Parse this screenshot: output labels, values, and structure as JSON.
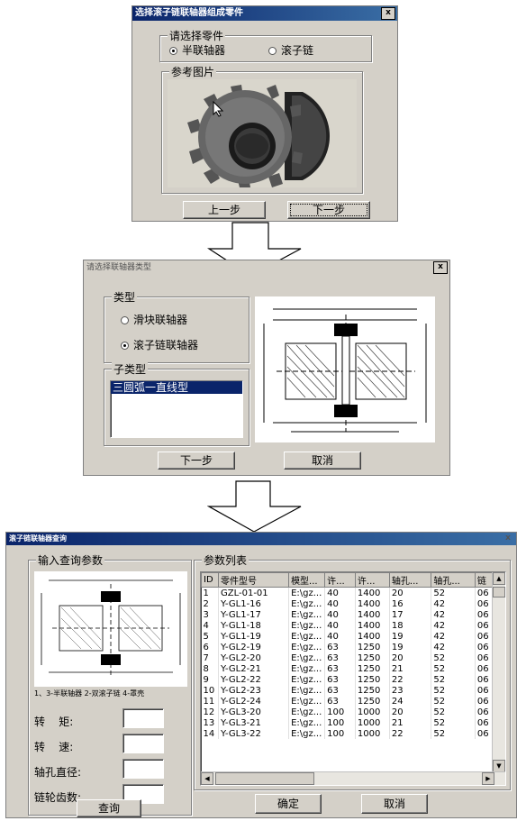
{
  "dialog1": {
    "title": "选择滚子链联轴器组成零件",
    "close": "x",
    "group_parts": "请选择零件",
    "radio_half": "半联轴器",
    "radio_chain": "滚子链",
    "group_image": "参考图片",
    "btn_prev": "上一步",
    "btn_next": "下一步"
  },
  "dialog2": {
    "title": "请选择联轴器类型",
    "close": "x",
    "group_type": "类型",
    "radio_slider": "滑块联轴器",
    "radio_roller": "滚子链联轴器",
    "group_subtype": "子类型",
    "subtype_selected": "三圆弧一直线型",
    "btn_next": "下一步",
    "btn_cancel": "取消"
  },
  "dialog3": {
    "title": "滚子链联轴器查询",
    "close": "x",
    "group_input": "输入查询参数",
    "caption": "1、3-半联轴器 2-双滚子链 4-罩壳",
    "label_torque": "转    矩:",
    "label_speed": "转    速:",
    "label_diameter": "轴孔直径:",
    "label_teeth": "链轮齿数:",
    "btn_query": "查询",
    "group_list": "参数列表",
    "columns": [
      "ID",
      "零件型号",
      "模型...",
      "许...",
      "许...",
      "轴孔...",
      "轴孔...",
      "链"
    ],
    "rows": [
      [
        "1",
        "GZL-01-01",
        "E:\\gz...",
        "40",
        "1400",
        "20",
        "52",
        "06"
      ],
      [
        "2",
        "Y-GL1-16",
        "E:\\gz...",
        "40",
        "1400",
        "16",
        "42",
        "06"
      ],
      [
        "3",
        "Y-GL1-17",
        "E:\\gz...",
        "40",
        "1400",
        "17",
        "42",
        "06"
      ],
      [
        "4",
        "Y-GL1-18",
        "E:\\gz...",
        "40",
        "1400",
        "18",
        "42",
        "06"
      ],
      [
        "5",
        "Y-GL1-19",
        "E:\\gz...",
        "40",
        "1400",
        "19",
        "42",
        "06"
      ],
      [
        "6",
        "Y-GL2-19",
        "E:\\gz...",
        "63",
        "1250",
        "19",
        "42",
        "06"
      ],
      [
        "7",
        "Y-GL2-20",
        "E:\\gz...",
        "63",
        "1250",
        "20",
        "52",
        "06"
      ],
      [
        "8",
        "Y-GL2-21",
        "E:\\gz...",
        "63",
        "1250",
        "21",
        "52",
        "06"
      ],
      [
        "9",
        "Y-GL2-22",
        "E:\\gz...",
        "63",
        "1250",
        "22",
        "52",
        "06"
      ],
      [
        "10",
        "Y-GL2-23",
        "E:\\gz...",
        "63",
        "1250",
        "23",
        "52",
        "06"
      ],
      [
        "11",
        "Y-GL2-24",
        "E:\\gz...",
        "63",
        "1250",
        "24",
        "52",
        "06"
      ],
      [
        "12",
        "Y-GL3-20",
        "E:\\gz...",
        "100",
        "1000",
        "20",
        "52",
        "06"
      ],
      [
        "13",
        "Y-GL3-21",
        "E:\\gz...",
        "100",
        "1000",
        "21",
        "52",
        "06"
      ],
      [
        "14",
        "Y-GL3-22",
        "E:\\gz...",
        "100",
        "1000",
        "22",
        "52",
        "06"
      ]
    ],
    "btn_ok": "确定",
    "btn_cancel": "取消"
  },
  "colors": {
    "title_blue": "#0a246a",
    "dialog_gray": "#d4d0c8",
    "selection": "#0a246a"
  },
  "icons": [
    "close-icon",
    "cursor-icon",
    "arrow-down-icon",
    "scroll-up-icon",
    "scroll-down-icon",
    "scroll-left-icon",
    "scroll-right-icon"
  ]
}
